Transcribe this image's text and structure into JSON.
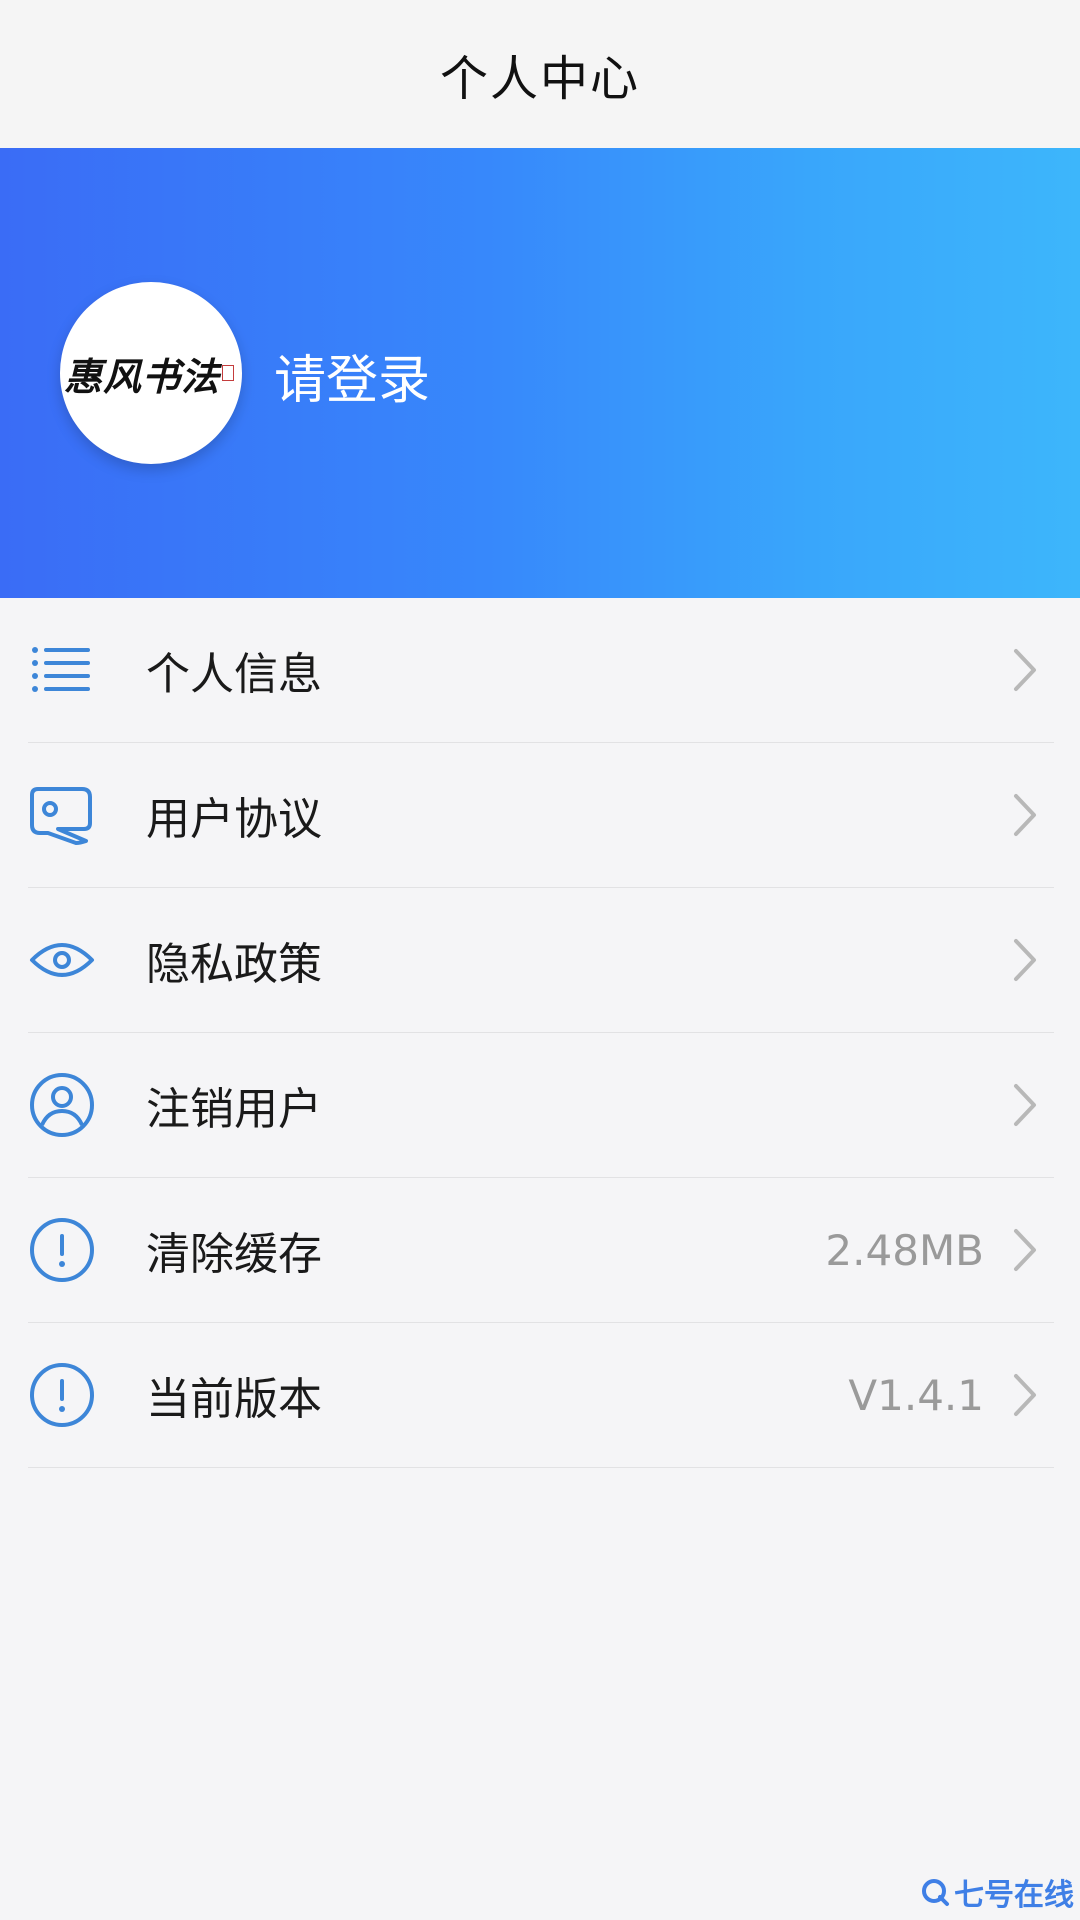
{
  "header": {
    "title": "个人中心"
  },
  "profile": {
    "avatar_logo_text": "惠风书法",
    "login_prompt": "请登录"
  },
  "menu": {
    "items": [
      {
        "label": "个人信息",
        "icon": "list-icon",
        "value": ""
      },
      {
        "label": "用户协议",
        "icon": "tag-icon",
        "value": ""
      },
      {
        "label": "隐私政策",
        "icon": "eye-icon",
        "value": ""
      },
      {
        "label": "注销用户",
        "icon": "user-circle-icon",
        "value": ""
      },
      {
        "label": "清除缓存",
        "icon": "exclamation-circle-icon",
        "value": "2.48MB"
      },
      {
        "label": "当前版本",
        "icon": "exclamation-circle-icon",
        "value": "V1.4.1"
      }
    ]
  },
  "watermark": {
    "text": "七号在线"
  },
  "colors": {
    "banner_start": "#3a6cf6",
    "banner_end": "#3db6fb",
    "icon": "#3d86d8",
    "chevron": "#b8b8b8",
    "value_text": "#9a9a9a"
  }
}
